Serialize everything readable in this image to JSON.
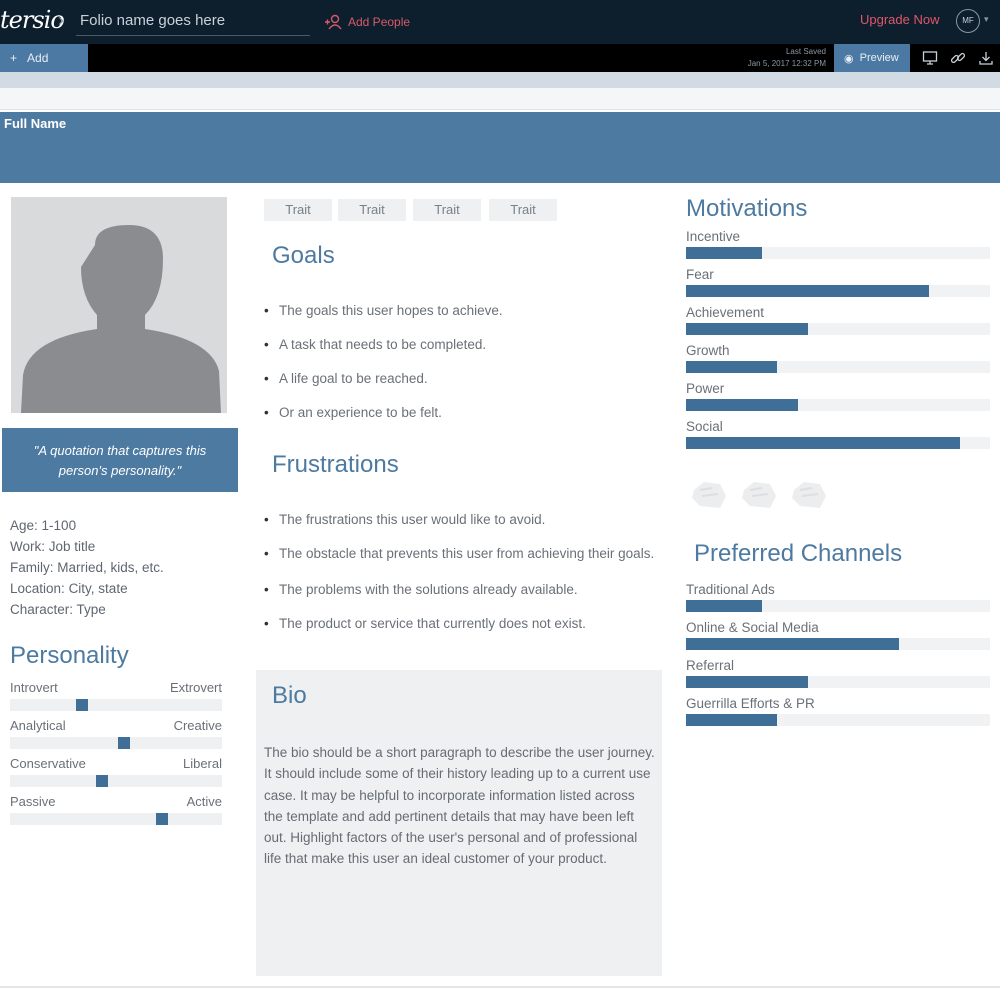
{
  "app": {
    "logo": "tersio",
    "folio_name": "Folio name goes here",
    "add_people": "Add People",
    "upgrade": "Upgrade Now",
    "user_initials": "MF"
  },
  "toolbar": {
    "add_label": "Add",
    "last_saved_label": "Last Saved",
    "last_saved_value": "Jan 5, 2017 12:32 PM",
    "preview_label": "Preview",
    "icons": [
      "monitor-icon",
      "link-icon",
      "download-icon"
    ]
  },
  "persona": {
    "full_name": "Full Name",
    "quote": "\"A quotation that captures this person's personality.\"",
    "demographics": [
      {
        "label": "Age:",
        "value": "1-100"
      },
      {
        "label": "Work:",
        "value": "Job title"
      },
      {
        "label": "Family:",
        "value": "Married, kids, etc."
      },
      {
        "label": "Location:",
        "value": "City, state"
      },
      {
        "label": "Character:",
        "value": "Type"
      }
    ]
  },
  "personality": {
    "title": "Personality",
    "sliders": [
      {
        "left": "Introvert",
        "right": "Extrovert",
        "value": 0.33
      },
      {
        "left": "Analytical",
        "right": "Creative",
        "value": 0.54
      },
      {
        "left": "Conservative",
        "right": "Liberal",
        "value": 0.43
      },
      {
        "left": "Passive",
        "right": "Active",
        "value": 0.73
      }
    ]
  },
  "traits": [
    "Trait",
    "Trait",
    "Trait",
    "Trait"
  ],
  "goals": {
    "title": "Goals",
    "items": [
      "The goals this user hopes to achieve.",
      "A task that needs to be completed.",
      "A life goal to be reached.",
      "Or an experience to be felt."
    ]
  },
  "frustrations": {
    "title": "Frustrations",
    "items": [
      "The frustrations this user would like to avoid.",
      "The obstacle that prevents this user from achieving their goals.",
      "The problems with the solutions already available.",
      "The product or service that currently does not exist."
    ]
  },
  "bio": {
    "title": "Bio",
    "text": "The bio should be a short paragraph to describe the user journey. It should include some of their history leading up to a current use case. It may be helpful to incorporate information listed across the template and add pertinent details that may have been left out. Highlight factors of the user's personal and of professional life that make this user an ideal customer of your product."
  },
  "motivations": {
    "title": "Motivations",
    "bars": [
      {
        "label": "Incentive",
        "value": 0.25
      },
      {
        "label": "Fear",
        "value": 0.8
      },
      {
        "label": "Achievement",
        "value": 0.4
      },
      {
        "label": "Growth",
        "value": 0.3
      },
      {
        "label": "Power",
        "value": 0.37
      },
      {
        "label": "Social",
        "value": 0.9
      }
    ]
  },
  "brands": [
    "brand-placeholder-icon",
    "brand-placeholder-icon",
    "brand-placeholder-icon"
  ],
  "channels": {
    "title": "Preferred Channels",
    "bars": [
      {
        "label": "Traditional Ads",
        "value": 0.25
      },
      {
        "label": "Online & Social Media",
        "value": 0.7
      },
      {
        "label": "Referral",
        "value": 0.4
      },
      {
        "label": "Guerrilla Efforts & PR",
        "value": 0.3
      }
    ]
  },
  "colors": {
    "accent": "#4d7aa1",
    "bar_fill": "#3f6e96",
    "topbar": "#0d1f2d",
    "alert": "#e0566a"
  }
}
